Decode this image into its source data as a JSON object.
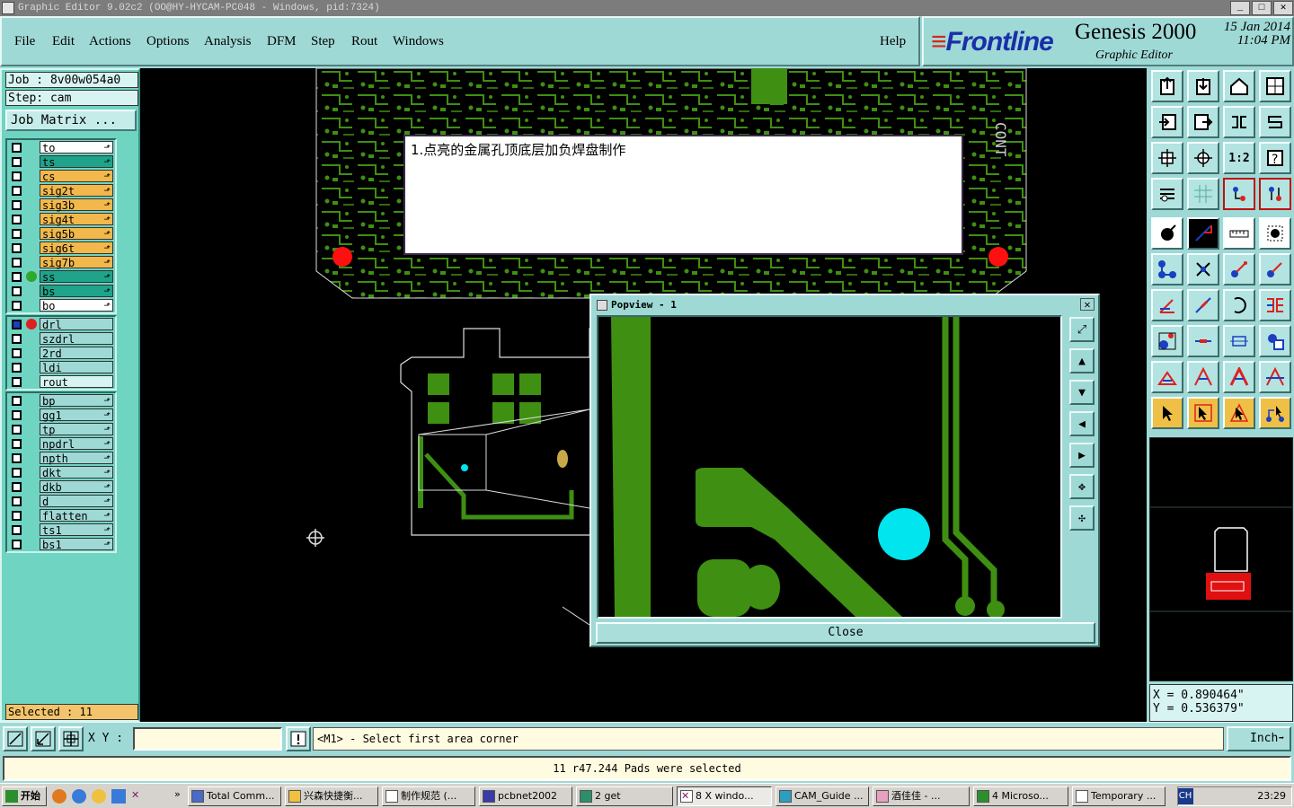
{
  "window": {
    "title": "Graphic Editor 9.02c2 (OO@HY-HYCAM-PC048 - Windows, pid:7324)"
  },
  "menu": [
    "File",
    "Edit",
    "Actions",
    "Options",
    "Analysis",
    "DFM",
    "Step",
    "Rout",
    "Windows"
  ],
  "help_label": "Help",
  "brand": {
    "logo": "Frontline",
    "product": "Genesis 2000",
    "subtitle": "Graphic Editor",
    "date": "15 Jan 2014",
    "time": "11:04 PM"
  },
  "job": {
    "job": "Job : 8v00w054a0",
    "step": "Step: cam",
    "matrix_button": "Job Matrix ..."
  },
  "layers_board": [
    {
      "name": "to",
      "color": "#ffffff",
      "dot": ""
    },
    {
      "name": "ts",
      "color": "#1fa38a",
      "dot": ""
    },
    {
      "name": "cs",
      "color": "#f2b84b",
      "dot": ""
    },
    {
      "name": "sig2t",
      "color": "#f2b84b",
      "dot": ""
    },
    {
      "name": "sig3b",
      "color": "#f2b84b",
      "dot": ""
    },
    {
      "name": "sig4t",
      "color": "#f2b84b",
      "dot": ""
    },
    {
      "name": "sig5b",
      "color": "#f2b84b",
      "dot": ""
    },
    {
      "name": "sig6t",
      "color": "#f2b84b",
      "dot": ""
    },
    {
      "name": "sig7b",
      "color": "#f2b84b",
      "dot": ""
    },
    {
      "name": "ss",
      "color": "#1fa38a",
      "dot": "#2ea82e"
    },
    {
      "name": "bs",
      "color": "#1fa38a",
      "dot": ""
    },
    {
      "name": "bo",
      "color": "#ffffff",
      "dot": ""
    }
  ],
  "layers_drill": [
    {
      "name": "drl",
      "color": "#9fd9d6"
    },
    {
      "name": "szdrl",
      "color": "#9fd9d6"
    },
    {
      "name": "2rd",
      "color": "#9fd9d6"
    },
    {
      "name": "ldi",
      "color": "#9fd9d6"
    },
    {
      "name": "rout",
      "color": "#d8f4f2"
    }
  ],
  "layers_misc": [
    {
      "name": "bp",
      "color": "#9fd9d6"
    },
    {
      "name": "gg1",
      "color": "#9fd9d6"
    },
    {
      "name": "tp",
      "color": "#9fd9d6"
    },
    {
      "name": "npdrl",
      "color": "#9fd9d6"
    },
    {
      "name": "npth",
      "color": "#9fd9d6"
    },
    {
      "name": "dkt",
      "color": "#9fd9d6"
    },
    {
      "name": "dkb",
      "color": "#9fd9d6"
    },
    {
      "name": "d",
      "color": "#9fd9d6"
    },
    {
      "name": "flatten",
      "color": "#9fd9d6"
    },
    {
      "name": "ts1",
      "color": "#9fd9d6"
    },
    {
      "name": "bs1",
      "color": "#9fd9d6"
    }
  ],
  "selected_label": "Selected : 11",
  "note_text": "1.点亮的金属孔顶底层加负焊盘制作",
  "popview": {
    "title": "Popview - 1",
    "close_label": "Close"
  },
  "coords": {
    "x": "X = 0.890464\"",
    "y": "Y = 0.536379\""
  },
  "status": {
    "xy_label": "X Y :",
    "xy_value": "",
    "prompt": "<M1> - Select first area corner",
    "unit": "Inch",
    "message": "11 r47.244 Pads were selected"
  },
  "taskbar": {
    "start": "开始",
    "tasks": [
      "Total Comm...",
      "兴森快捷衡...",
      "制作规范 (...",
      "pcbnet2002",
      "2 get",
      "8 X windo...",
      "CAM_Guide ...",
      "酒佳佳 - ...",
      "4 Microso...",
      "Temporary ..."
    ],
    "lang": "CH",
    "clock": "23:29"
  },
  "colors": {
    "panel": "#9fd9d6",
    "copper": "#3f8f12",
    "pad_highlight": "#00e5ee",
    "red_marker": "#ff1010"
  }
}
